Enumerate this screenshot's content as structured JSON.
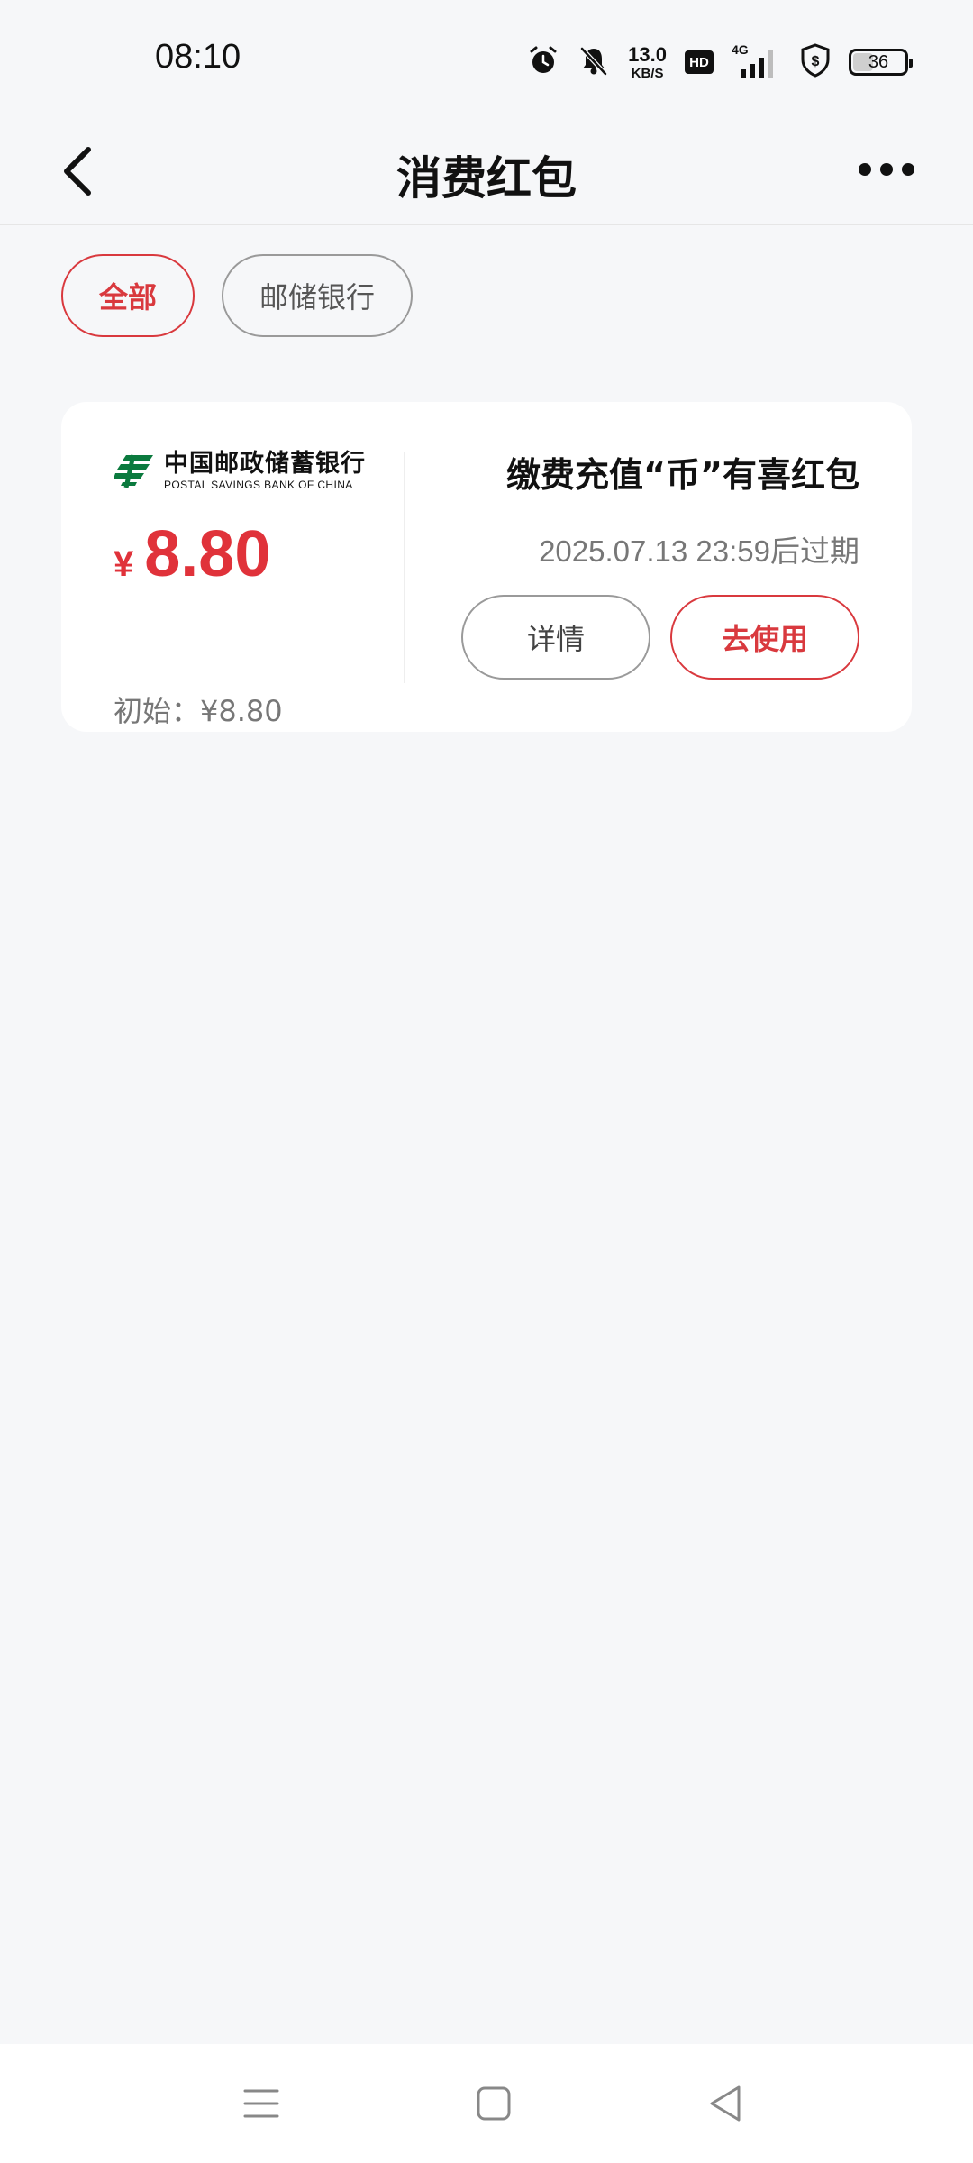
{
  "status_bar": {
    "time": "08:10",
    "net_speed_value": "13.0",
    "net_speed_unit": "KB/S",
    "hd_label": "HD",
    "network": "4G",
    "battery_level": "36",
    "battery_fraction": 0.36,
    "icons": [
      "alarm-icon",
      "mute-bell-icon",
      "signal-icon",
      "shield-dollar-icon",
      "battery-icon"
    ]
  },
  "nav": {
    "title": "消费红包",
    "back_icon": "chevron-left-icon",
    "more_icon": "more-dots-icon"
  },
  "filters": {
    "all_label": "全部",
    "bank_label": "邮储银行",
    "selected": "全部"
  },
  "coupon": {
    "bank_name_cn": "中国邮政储蓄银行",
    "bank_name_en": "POSTAL SAVINGS BANK OF CHINA",
    "currency_symbol": "¥",
    "amount": "8.80",
    "initial_label": "初始：¥8.80",
    "title": "缴费充值“币”有喜红包",
    "expire_text": "2025.07.13 23:59后过期",
    "detail_label": "详情",
    "use_label": "去使用"
  },
  "colors": {
    "accent_red": "#d9393e",
    "amount_red": "#e0323a",
    "logo_green": "#0b7a3e",
    "background": "#f6f7f9"
  },
  "system_nav": {
    "icons": [
      "menu-icon",
      "home-square-icon",
      "back-triangle-icon"
    ]
  }
}
